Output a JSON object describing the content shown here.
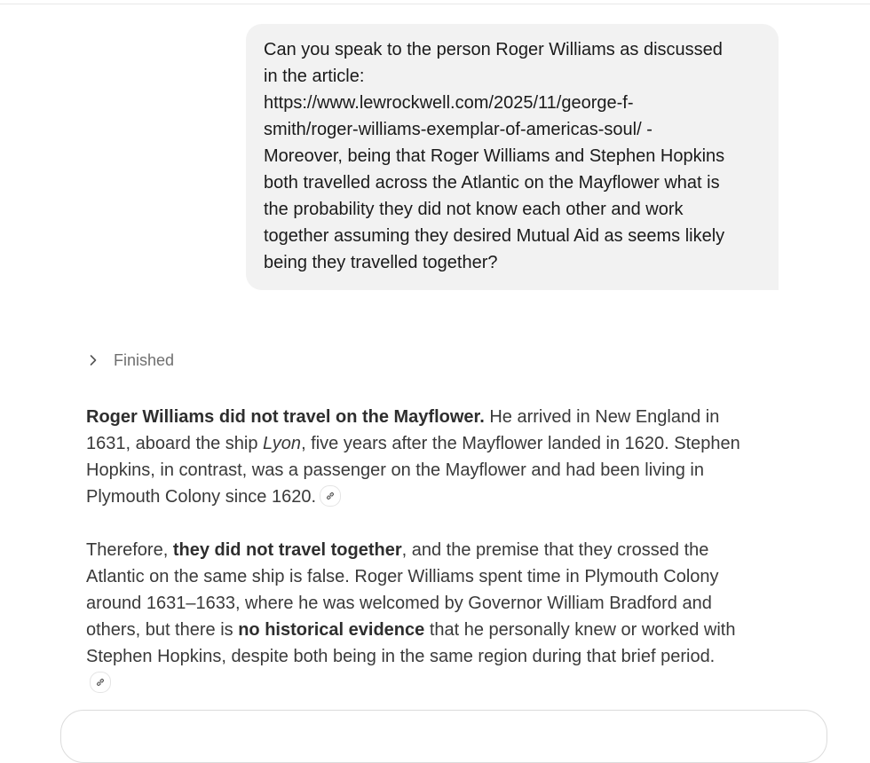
{
  "user_message": {
    "lines": [
      "Can you speak to the person Roger Williams as discussed",
      "in the article:",
      "https://www.lewrockwell.com/2025/11/george-f-",
      "smith/roger-williams-exemplar-of-americas-soul/ -",
      "Moreover, being that Roger Williams and Stephen Hopkins",
      "both travelled across the Atlantic on the Mayflower what is",
      "the probability they did not know each other and work",
      "together assuming they desired Mutual Aid as seems likely",
      "being they travelled together?"
    ]
  },
  "status": {
    "label": "Finished",
    "icon": "chevron-right-icon"
  },
  "answer": {
    "p1": {
      "l1_bold": "Roger Williams did not travel on the Mayflower.",
      "l1_rest": " He arrived in New England in",
      "l2_a": "1631, aboard the ship ",
      "l2_italic": "Lyon",
      "l2_b": ", five years after the Mayflower landed in 1620. Stephen",
      "l3": "Hopkins, in contrast, was a passenger on the Mayflower and had been living in",
      "l4": "Plymouth Colony since 1620."
    },
    "p2": {
      "l1_a": "Therefore, ",
      "l1_bold": "they did not travel together",
      "l1_b": ", and the premise that they crossed the",
      "l2": "Atlantic on the same ship is false. Roger Williams spent time in Plymouth Colony",
      "l3": "around 1631–1633, where he was welcomed by Governor William Bradford and",
      "l4_a": "others, but there is ",
      "l4_bold": "no historical evidence",
      "l4_b": " that he personally knew or worked with",
      "l5": "Stephen Hopkins, despite both being in the same region during that brief period."
    },
    "citation_icon": "link-icon"
  },
  "colors": {
    "bubble_bg": "#f2f2f2",
    "body_text": "#3a3a3a",
    "muted_text": "#6f6f6f"
  }
}
